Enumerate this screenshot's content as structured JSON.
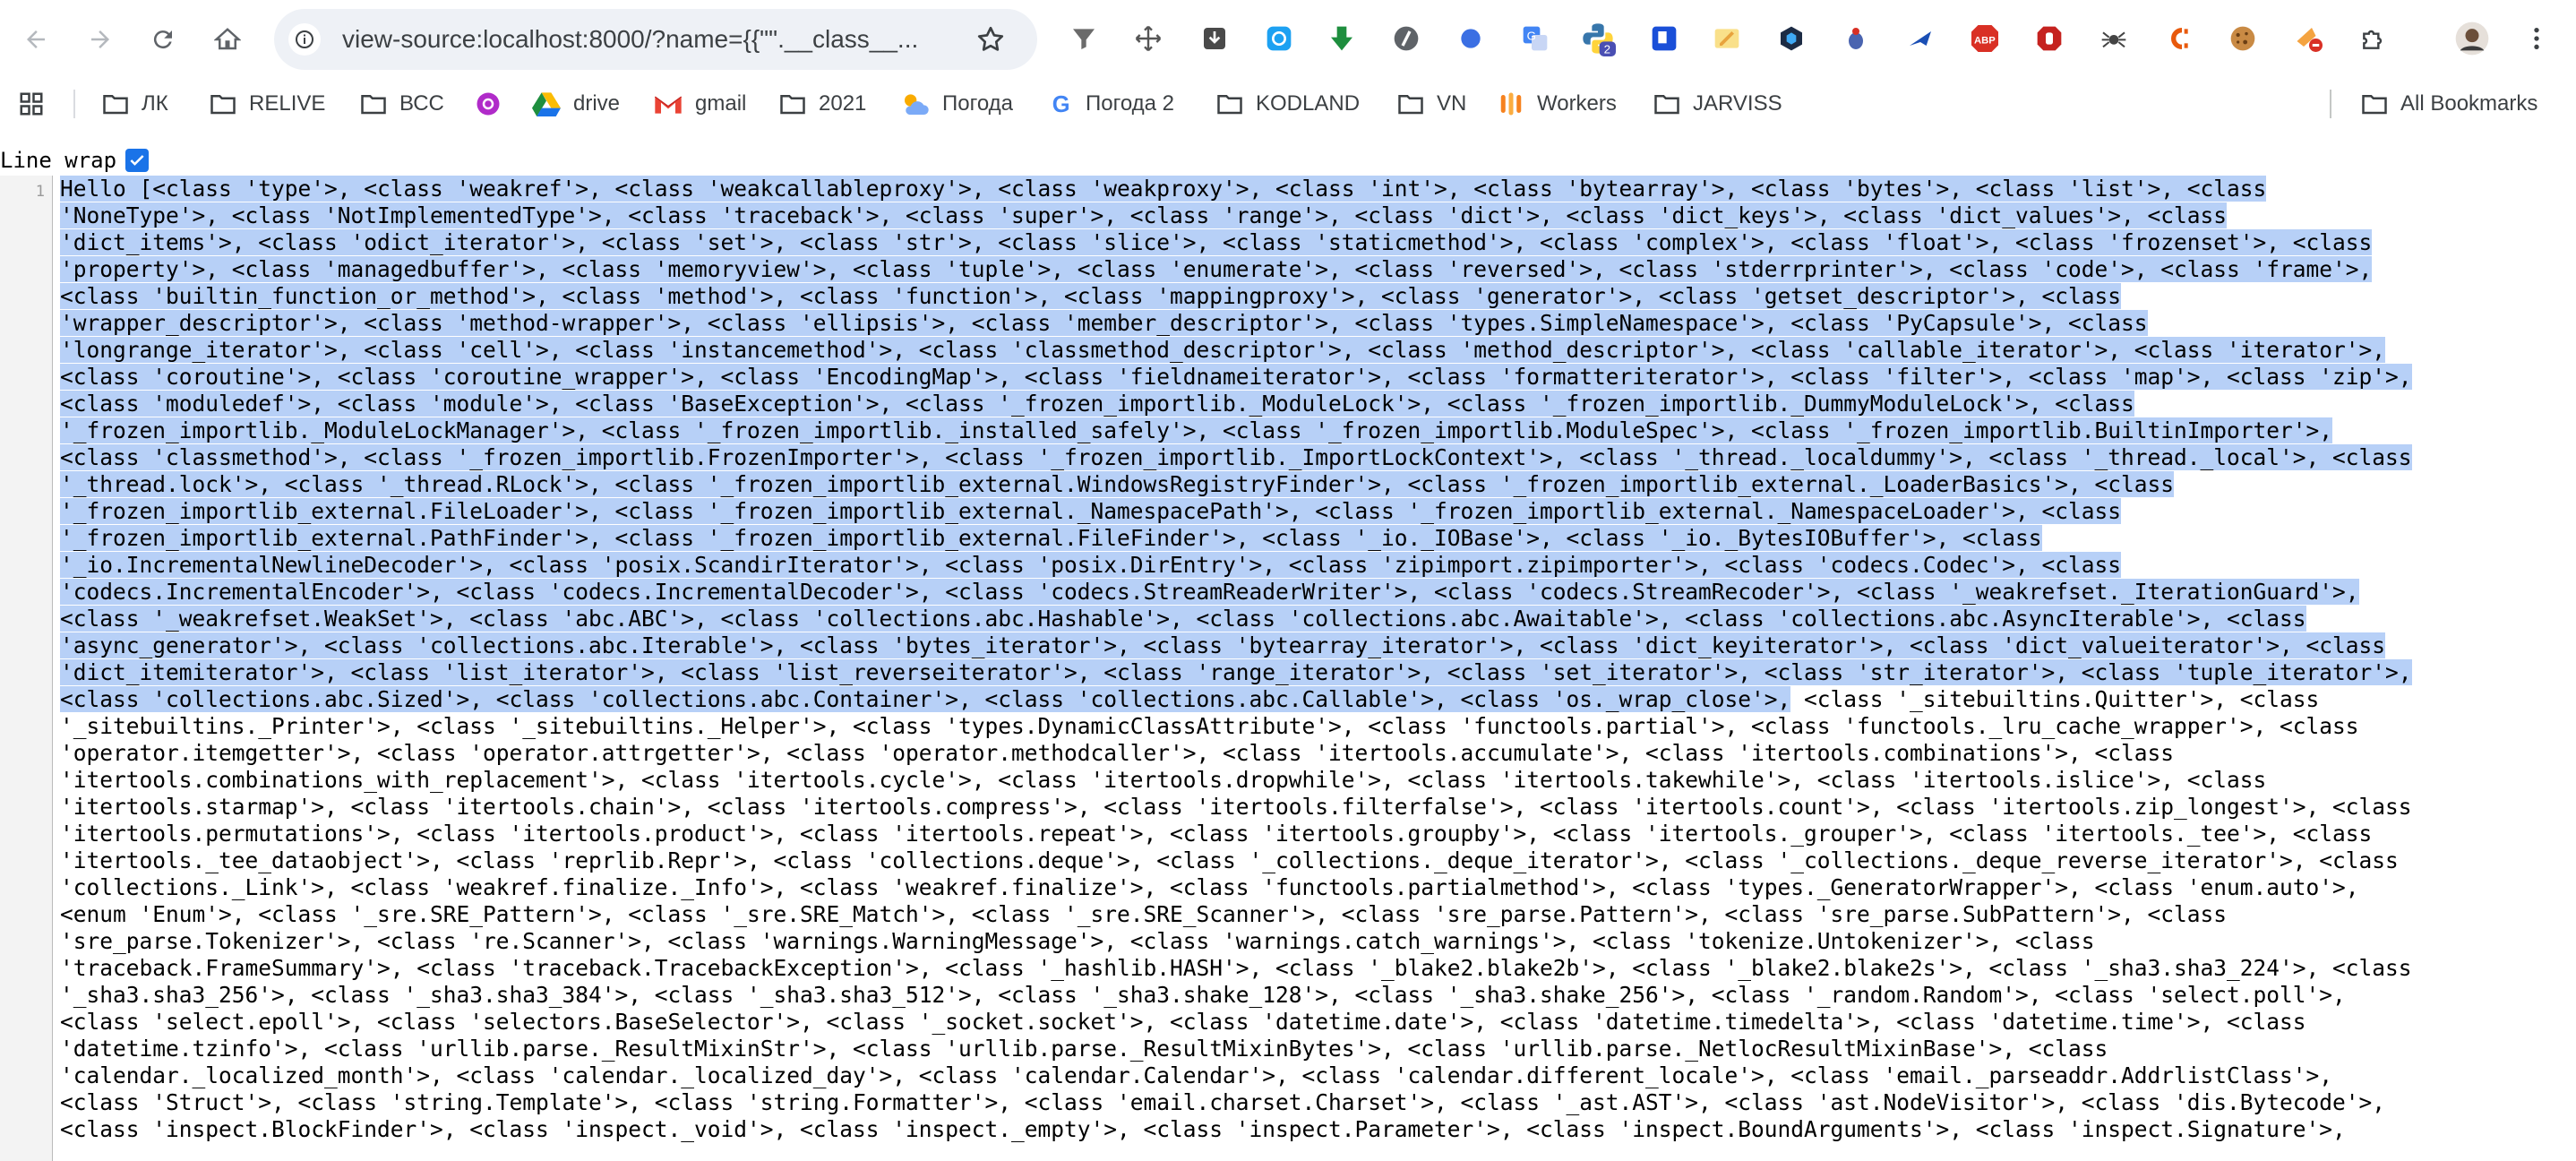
{
  "browser": {
    "url": "view-source:localhost:8000/?name={{\"\".__class__...",
    "bookmarks": [
      "ЛК",
      "RELIVE",
      "ВСС",
      "drive",
      "gmail",
      "2021",
      "Погода",
      "Погода 2",
      "KODLAND",
      "VN",
      "Workers",
      "JARVISS"
    ],
    "all_bookmarks": "All Bookmarks",
    "extensions": [
      "funnel-ext-icon",
      "move-ext-icon",
      "download-box-ext-icon",
      "circle-arrows-ext-icon",
      "green-down-arrow-ext-icon",
      "slash-circle-ext-icon",
      "blue-dot-ext-icon",
      "translate-ext-icon",
      "python-ext-icon",
      "blue-square-ext-icon",
      "pencil-ext-icon",
      "hex-shield-ext-icon",
      "bug-ext-icon",
      "arrow-ext-icon",
      "abp-ext-icon",
      "red-hand-ext-icon",
      "spider-ext-icon",
      "c-logo-ext-icon",
      "cookie-ext-icon",
      "cake-ext-icon",
      "puzzle-ext-icon",
      "avatar",
      "menu-dots-icon"
    ],
    "python_badge": "2",
    "abp_label": "ABP"
  },
  "viewer": {
    "line_wrap_label": "Line wrap",
    "line_number": "1",
    "colors": {
      "selection": "#b7d0f7",
      "accent": "#1a73e8"
    },
    "lines": [
      {
        "sel": "Hello [<class 'type'>, <class 'weakref'>, <class 'weakcallableproxy'>, <class 'weakproxy'>, <class 'int'>, <class 'bytearray'>, <class 'bytes'>, <class 'list'>, <class",
        "rest": ""
      },
      {
        "sel": "'NoneType'>, <class 'NotImplementedType'>, <class 'traceback'>, <class 'super'>, <class 'range'>, <class 'dict'>, <class 'dict_keys'>, <class 'dict_values'>, <class",
        "rest": ""
      },
      {
        "sel": "'dict_items'>, <class 'odict_iterator'>, <class 'set'>, <class 'str'>, <class 'slice'>, <class 'staticmethod'>, <class 'complex'>, <class 'float'>, <class 'frozenset'>, <class",
        "rest": ""
      },
      {
        "sel": "'property'>, <class 'managedbuffer'>, <class 'memoryview'>, <class 'tuple'>, <class 'enumerate'>, <class 'reversed'>, <class 'stderrprinter'>, <class 'code'>, <class 'frame'>,",
        "rest": ""
      },
      {
        "sel": "<class 'builtin_function_or_method'>, <class 'method'>, <class 'function'>, <class 'mappingproxy'>, <class 'generator'>, <class 'getset_descriptor'>, <class",
        "rest": ""
      },
      {
        "sel": "'wrapper_descriptor'>, <class 'method-wrapper'>, <class 'ellipsis'>, <class 'member_descriptor'>, <class 'types.SimpleNamespace'>, <class 'PyCapsule'>, <class",
        "rest": ""
      },
      {
        "sel": "'longrange_iterator'>, <class 'cell'>, <class 'instancemethod'>, <class 'classmethod_descriptor'>, <class 'method_descriptor'>, <class 'callable_iterator'>, <class 'iterator'>,",
        "rest": ""
      },
      {
        "sel": "<class 'coroutine'>, <class 'coroutine_wrapper'>, <class 'EncodingMap'>, <class 'fieldnameiterator'>, <class 'formatteriterator'>, <class 'filter'>, <class 'map'>, <class 'zip'>,",
        "rest": ""
      },
      {
        "sel": "<class 'moduledef'>, <class 'module'>, <class 'BaseException'>, <class '_frozen_importlib._ModuleLock'>, <class '_frozen_importlib._DummyModuleLock'>, <class",
        "rest": ""
      },
      {
        "sel": "'_frozen_importlib._ModuleLockManager'>, <class '_frozen_importlib._installed_safely'>, <class '_frozen_importlib.ModuleSpec'>, <class '_frozen_importlib.BuiltinImporter'>,",
        "rest": ""
      },
      {
        "sel": "<class 'classmethod'>, <class '_frozen_importlib.FrozenImporter'>, <class '_frozen_importlib._ImportLockContext'>, <class '_thread._localdummy'>, <class '_thread._local'>, <class",
        "rest": ""
      },
      {
        "sel": "'_thread.lock'>, <class '_thread.RLock'>, <class '_frozen_importlib_external.WindowsRegistryFinder'>, <class '_frozen_importlib_external._LoaderBasics'>, <class",
        "rest": ""
      },
      {
        "sel": "'_frozen_importlib_external.FileLoader'>, <class '_frozen_importlib_external._NamespacePath'>, <class '_frozen_importlib_external._NamespaceLoader'>, <class",
        "rest": ""
      },
      {
        "sel": "'_frozen_importlib_external.PathFinder'>, <class '_frozen_importlib_external.FileFinder'>, <class '_io._IOBase'>, <class '_io._BytesIOBuffer'>, <class",
        "rest": ""
      },
      {
        "sel": "'_io.IncrementalNewlineDecoder'>, <class 'posix.ScandirIterator'>, <class 'posix.DirEntry'>, <class 'zipimport.zipimporter'>, <class 'codecs.Codec'>, <class",
        "rest": ""
      },
      {
        "sel": "'codecs.IncrementalEncoder'>, <class 'codecs.IncrementalDecoder'>, <class 'codecs.StreamReaderWriter'>, <class 'codecs.StreamRecoder'>, <class '_weakrefset._IterationGuard'>,",
        "rest": ""
      },
      {
        "sel": "<class '_weakrefset.WeakSet'>, <class 'abc.ABC'>, <class 'collections.abc.Hashable'>, <class 'collections.abc.Awaitable'>, <class 'collections.abc.AsyncIterable'>, <class",
        "rest": ""
      },
      {
        "sel": "'async_generator'>, <class 'collections.abc.Iterable'>, <class 'bytes_iterator'>, <class 'bytearray_iterator'>, <class 'dict_keyiterator'>, <class 'dict_valueiterator'>, <class",
        "rest": ""
      },
      {
        "sel": "'dict_itemiterator'>, <class 'list_iterator'>, <class 'list_reverseiterator'>, <class 'range_iterator'>, <class 'set_iterator'>, <class 'str_iterator'>, <class 'tuple_iterator'>,",
        "rest": ""
      },
      {
        "sel": "<class 'collections.abc.Sized'>, <class 'collections.abc.Container'>, <class 'collections.abc.Callable'>, <class 'os._wrap_close'>,",
        "rest": " <class '_sitebuiltins.Quitter'>, <class"
      },
      {
        "sel": "",
        "rest": "'_sitebuiltins._Printer'>, <class '_sitebuiltins._Helper'>, <class 'types.DynamicClassAttribute'>, <class 'functools.partial'>, <class 'functools._lru_cache_wrapper'>, <class"
      },
      {
        "sel": "",
        "rest": "'operator.itemgetter'>, <class 'operator.attrgetter'>, <class 'operator.methodcaller'>, <class 'itertools.accumulate'>, <class 'itertools.combinations'>, <class"
      },
      {
        "sel": "",
        "rest": "'itertools.combinations_with_replacement'>, <class 'itertools.cycle'>, <class 'itertools.dropwhile'>, <class 'itertools.takewhile'>, <class 'itertools.islice'>, <class"
      },
      {
        "sel": "",
        "rest": "'itertools.starmap'>, <class 'itertools.chain'>, <class 'itertools.compress'>, <class 'itertools.filterfalse'>, <class 'itertools.count'>, <class 'itertools.zip_longest'>, <class"
      },
      {
        "sel": "",
        "rest": "'itertools.permutations'>, <class 'itertools.product'>, <class 'itertools.repeat'>, <class 'itertools.groupby'>, <class 'itertools._grouper'>, <class 'itertools._tee'>, <class"
      },
      {
        "sel": "",
        "rest": "'itertools._tee_dataobject'>, <class 'reprlib.Repr'>, <class 'collections.deque'>, <class '_collections._deque_iterator'>, <class '_collections._deque_reverse_iterator'>, <class"
      },
      {
        "sel": "",
        "rest": "'collections._Link'>, <class 'weakref.finalize._Info'>, <class 'weakref.finalize'>, <class 'functools.partialmethod'>, <class 'types._GeneratorWrapper'>, <class 'enum.auto'>,"
      },
      {
        "sel": "",
        "rest": "<enum 'Enum'>, <class '_sre.SRE_Pattern'>, <class '_sre.SRE_Match'>, <class '_sre.SRE_Scanner'>, <class 'sre_parse.Pattern'>, <class 'sre_parse.SubPattern'>, <class"
      },
      {
        "sel": "",
        "rest": "'sre_parse.Tokenizer'>, <class 're.Scanner'>, <class 'warnings.WarningMessage'>, <class 'warnings.catch_warnings'>, <class 'tokenize.Untokenizer'>, <class"
      },
      {
        "sel": "",
        "rest": "'traceback.FrameSummary'>, <class 'traceback.TracebackException'>, <class '_hashlib.HASH'>, <class '_blake2.blake2b'>, <class '_blake2.blake2s'>, <class '_sha3.sha3_224'>, <class"
      },
      {
        "sel": "",
        "rest": "'_sha3.sha3_256'>, <class '_sha3.sha3_384'>, <class '_sha3.sha3_512'>, <class '_sha3.shake_128'>, <class '_sha3.shake_256'>, <class '_random.Random'>, <class 'select.poll'>,"
      },
      {
        "sel": "",
        "rest": "<class 'select.epoll'>, <class 'selectors.BaseSelector'>, <class '_socket.socket'>, <class 'datetime.date'>, <class 'datetime.timedelta'>, <class 'datetime.time'>, <class"
      },
      {
        "sel": "",
        "rest": "'datetime.tzinfo'>, <class 'urllib.parse._ResultMixinStr'>, <class 'urllib.parse._ResultMixinBytes'>, <class 'urllib.parse._NetlocResultMixinBase'>, <class"
      },
      {
        "sel": "",
        "rest": "'calendar._localized_month'>, <class 'calendar._localized_day'>, <class 'calendar.Calendar'>, <class 'calendar.different_locale'>, <class 'email._parseaddr.AddrlistClass'>,"
      },
      {
        "sel": "",
        "rest": "<class 'Struct'>, <class 'string.Template'>, <class 'string.Formatter'>, <class 'email.charset.Charset'>, <class '_ast.AST'>, <class 'ast.NodeVisitor'>, <class 'dis.Bytecode'>,"
      },
      {
        "sel": "",
        "rest": "<class 'inspect.BlockFinder'>, <class 'inspect._void'>, <class 'inspect._empty'>, <class 'inspect.Parameter'>, <class 'inspect.BoundArguments'>, <class 'inspect.Signature'>,"
      }
    ]
  }
}
